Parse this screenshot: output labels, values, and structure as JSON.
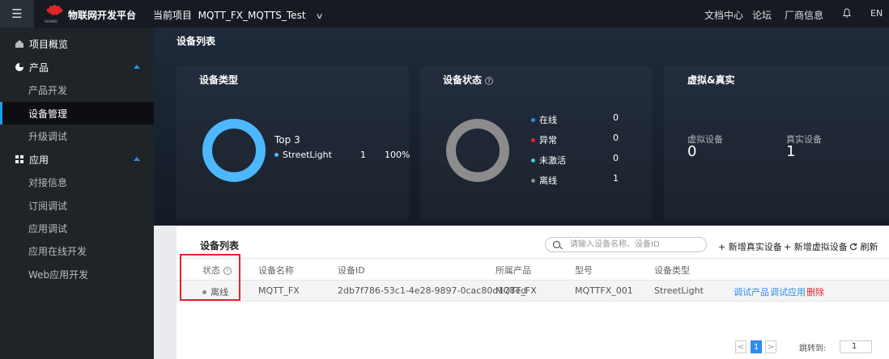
{
  "topbar": {
    "brand": "物联网开发平台",
    "logo_text": "HUAWEI",
    "project_label": "当前项目",
    "project_name": "MQTT_FX_MQTTS_Test",
    "nav": [
      "文档中心",
      "论坛",
      "厂商信息"
    ],
    "lang": "EN"
  },
  "sidebar": {
    "items": [
      {
        "label": "项目概览",
        "type": "group",
        "icon": "home-icon"
      },
      {
        "label": "产品",
        "type": "group",
        "icon": "product-icon",
        "expanded": true
      },
      {
        "label": "产品开发",
        "type": "sub"
      },
      {
        "label": "设备管理",
        "type": "sub",
        "active": true
      },
      {
        "label": "升级调试",
        "type": "sub"
      },
      {
        "label": "应用",
        "type": "group",
        "icon": "grid-icon",
        "expanded": true
      },
      {
        "label": "对接信息",
        "type": "sub"
      },
      {
        "label": "订阅调试",
        "type": "sub"
      },
      {
        "label": "应用调试",
        "type": "sub"
      },
      {
        "label": "应用在线开发",
        "type": "sub"
      },
      {
        "label": "Web应用开发",
        "type": "sub"
      }
    ]
  },
  "hero": {
    "title": "设备列表",
    "device_type": {
      "title": "设备类型",
      "top_label": "Top 3",
      "items": [
        {
          "name": "StreetLight",
          "count": "1",
          "percent": "100%",
          "color": "#4db8ff"
        }
      ]
    },
    "device_status": {
      "title": "设备状态",
      "items": [
        {
          "name": "在线",
          "count": "0",
          "color": "#2d8cf0"
        },
        {
          "name": "异常",
          "count": "0",
          "color": "#e0262b"
        },
        {
          "name": "未激活",
          "count": "0",
          "color": "#4ec9d9"
        },
        {
          "name": "离线",
          "count": "1",
          "color": "#8c8c8c"
        }
      ]
    },
    "virtual_real": {
      "title": "虚拟&真实",
      "virtual_label": "虚拟设备",
      "virtual_count": "0",
      "real_label": "真实设备",
      "real_count": "1"
    }
  },
  "table": {
    "title": "设备列表",
    "search_placeholder": "请输入设备名称、设备ID",
    "actions": [
      "+ 新增真实设备",
      "+ 新增虚拟设备",
      "刷新"
    ],
    "columns": [
      "状态",
      "设备名称",
      "设备ID",
      "所属产品",
      "型号",
      "设备类型"
    ],
    "rows": [
      {
        "status": "离线",
        "name": "MQTT_FX",
        "id": "2db7f786-53c1-4e28-9897-0cac80d178ed",
        "product": "MQTT_FX",
        "model": "MQTTFX_001",
        "type": "StreetLight",
        "ops": [
          "调试产品",
          "调试应用",
          "删除"
        ]
      }
    ]
  },
  "pagination": {
    "prev": "<",
    "current": "1",
    "next": ">",
    "jump_label": "跳转到:",
    "jump_value": "1"
  }
}
